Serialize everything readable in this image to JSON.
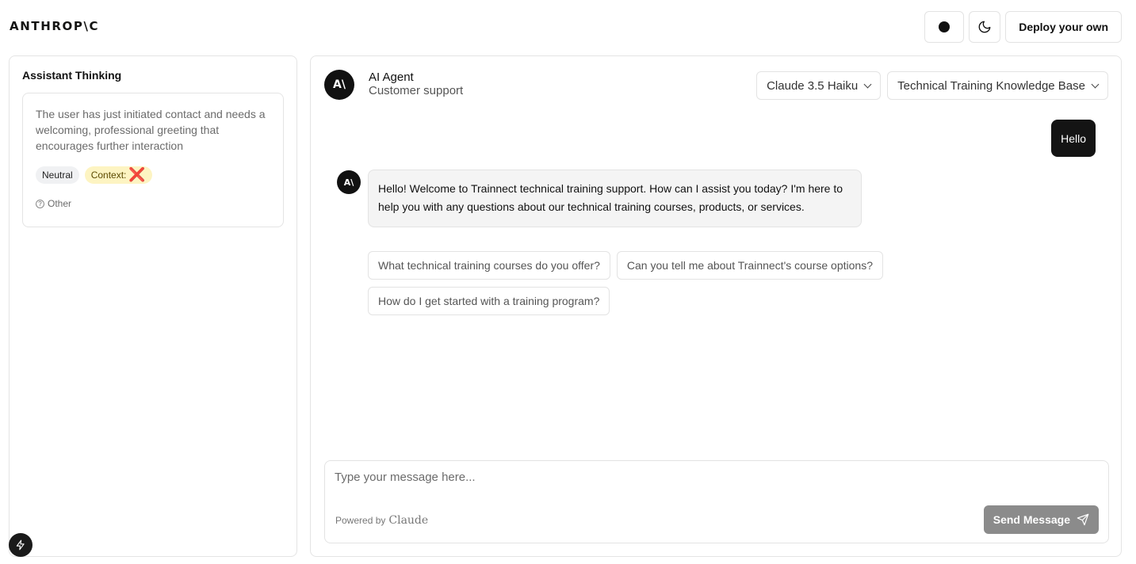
{
  "header": {
    "logo": "ANTHROP\\C",
    "theme_dot_icon": "circle-icon",
    "dark_mode_icon": "moon-icon",
    "deploy_label": "Deploy your own"
  },
  "thinking_panel": {
    "title": "Assistant Thinking",
    "thought": "The user has just initiated contact and needs a welcoming, professional greeting that encourages further interaction",
    "tags": {
      "sentiment": "Neutral",
      "context_label": "Context:",
      "context_mark": "❌"
    },
    "category": "Other"
  },
  "chat": {
    "agent_initials": "A\\",
    "agent_name": "AI Agent",
    "agent_role": "Customer support",
    "model_select": "Claude 3.5 Haiku",
    "kb_select": "Technical Training Knowledge Base",
    "messages": [
      {
        "role": "user",
        "text": "Hello"
      },
      {
        "role": "assistant",
        "text": "Hello! Welcome to Trainnect technical training support. How can I assist you today? I'm here to help you with any questions about our technical training courses, products, or services."
      }
    ],
    "suggestions": [
      "What technical training courses do you offer?",
      "Can you tell me about Trainnect's course options?",
      "How do I get started with a training program?"
    ]
  },
  "composer": {
    "placeholder": "Type your message here...",
    "powered_by": "Powered by",
    "powered_brand": "Claude",
    "send_label": "Send Message",
    "send_icon": "paper-plane-icon"
  },
  "colors": {
    "primary_dark": "#141414",
    "send_disabled": "#8b8b8b",
    "context_tag_bg": "#fdf4c2",
    "neutral_tag_bg": "#f0f1f3"
  }
}
